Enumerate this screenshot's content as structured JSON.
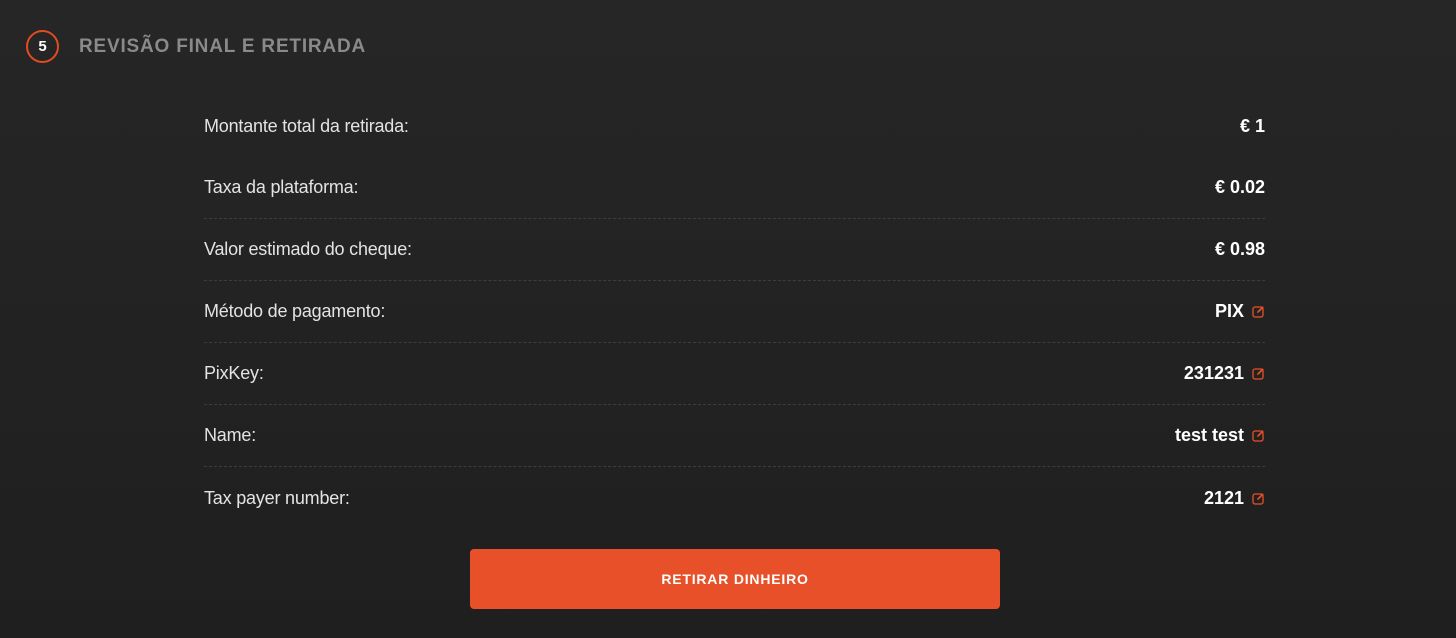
{
  "step": {
    "number": "5",
    "title": "REVISÃO FINAL E RETIRADA"
  },
  "summary": {
    "rows": [
      {
        "label": "Montante total da retirada:",
        "value": "€ 1",
        "editable": false
      },
      {
        "label": "Taxa da plataforma:",
        "value": "€ 0.02",
        "editable": false
      },
      {
        "label": "Valor estimado do cheque:",
        "value": "€ 0.98",
        "editable": false
      },
      {
        "label": "Método de pagamento:",
        "value": "PIX",
        "editable": true
      },
      {
        "label": "PixKey:",
        "value": "231231",
        "editable": true
      },
      {
        "label": "Name:",
        "value": "test test",
        "editable": true
      },
      {
        "label": "Tax payer number:",
        "value": "2121",
        "editable": true
      }
    ]
  },
  "button": {
    "label": "RETIRAR DINHEIRO"
  },
  "colors": {
    "accent": "#e8502a",
    "background": "#232323",
    "title_muted": "#8a8a8a",
    "divider": "#3d3d3d"
  },
  "icons": {
    "edit": "edit-square-icon"
  }
}
